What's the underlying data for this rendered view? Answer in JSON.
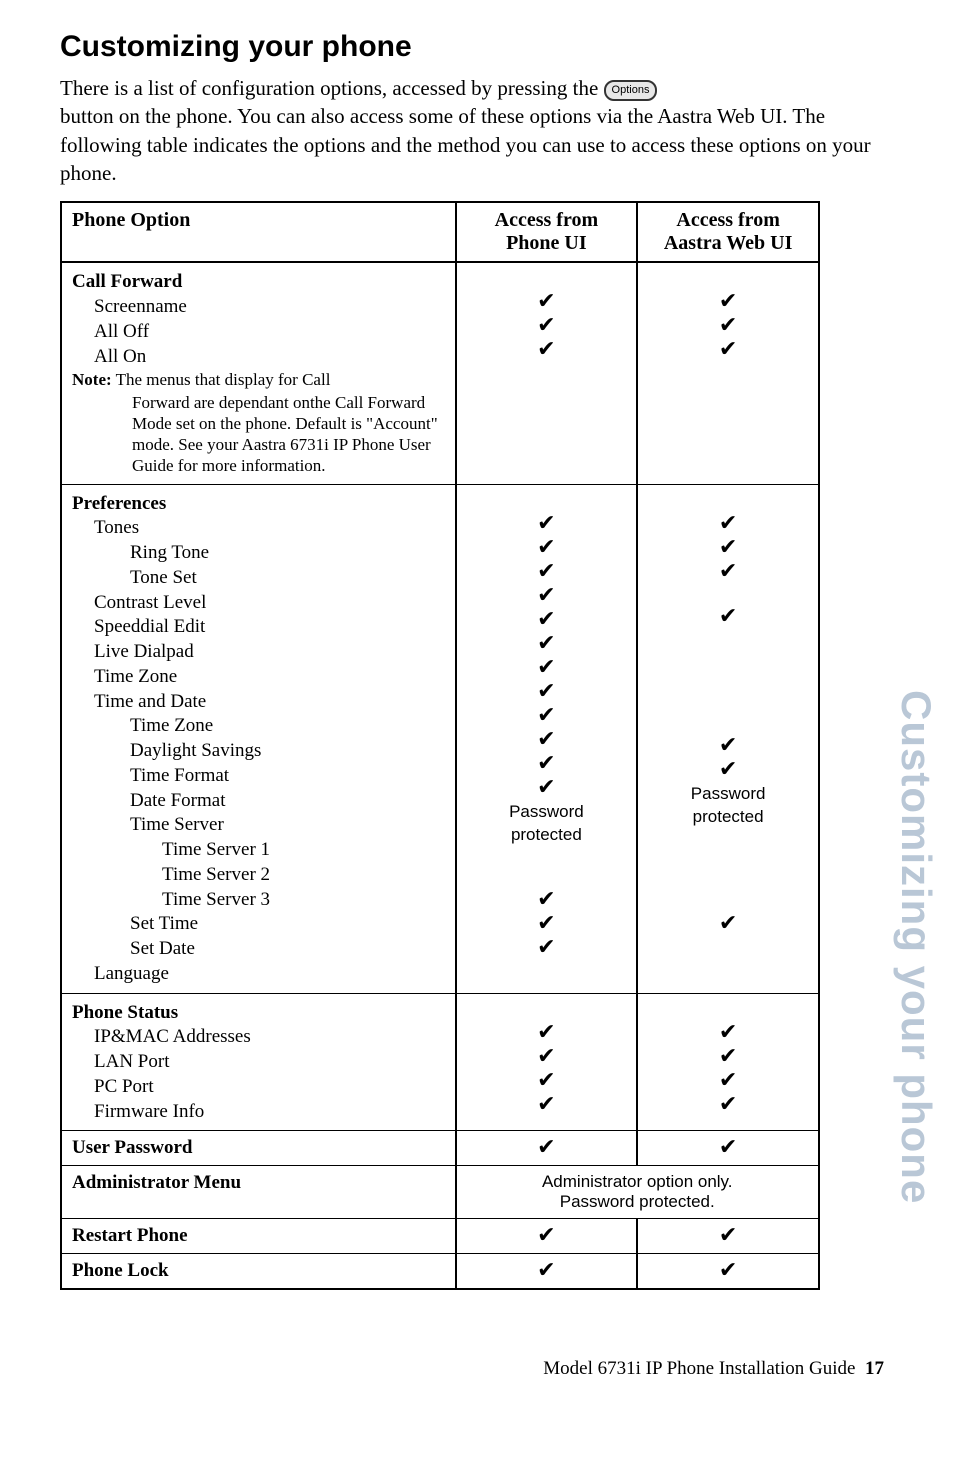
{
  "title": "Customizing your phone",
  "intro_lines": [
    "There is a list of configuration options, accessed by pressing the",
    "button on the phone. You can also access some of these options via the Aastra Web UI. The following table indicates the options and the method you can use to access these options on your phone."
  ],
  "options_chip": "Options",
  "table": {
    "headers": {
      "option": "Phone Option",
      "phone_ui": "Access from Phone UI",
      "web_ui": "Access from Aastra Web UI"
    },
    "sections": [
      {
        "group": "Call Forward",
        "items": [
          {
            "label": "Screenname",
            "indent": 1,
            "phone": "check",
            "web": "check"
          },
          {
            "label": "All Off",
            "indent": 1,
            "phone": "check",
            "web": "check"
          },
          {
            "label": "All On",
            "indent": 1,
            "phone": "check",
            "web": "check"
          }
        ],
        "note": {
          "label": "Note:",
          "first_line": "The menus that display for Call",
          "rest": "Forward are dependant onthe Call Forward Mode set on the phone. Default is \"Account\" mode. See your Aastra 6731i IP Phone User Guide for more information."
        }
      },
      {
        "group": "Preferences",
        "items": [
          {
            "label": "Tones",
            "indent": 1,
            "phone": "check",
            "web": "check"
          },
          {
            "label": "Ring Tone",
            "indent": 2,
            "phone": "check",
            "web": "check"
          },
          {
            "label": "Tone Set",
            "indent": 2,
            "phone": "check",
            "web": "check"
          },
          {
            "label": "Contrast Level",
            "indent": 1,
            "phone": "check",
            "web": ""
          },
          {
            "label": "Speeddial Edit",
            "indent": 1,
            "phone": "check",
            "web": "check"
          },
          {
            "label": "Live Dialpad",
            "indent": 1,
            "phone": "check",
            "web": ""
          },
          {
            "label": "Time Zone",
            "indent": 1,
            "phone": "check",
            "web": ""
          },
          {
            "label": "Time and Date",
            "indent": 1,
            "phone": "check",
            "web": ""
          },
          {
            "label": "Time Zone",
            "indent": 2,
            "phone": "check",
            "web": ""
          },
          {
            "label": "Daylight Savings",
            "indent": 2,
            "phone": "check",
            "web": ""
          },
          {
            "label": "Time Format",
            "indent": 2,
            "phone": "check",
            "web": "check"
          },
          {
            "label": "Date Format",
            "indent": 2,
            "phone": "check",
            "web": "check"
          },
          {
            "label": "Time Server",
            "indent": 2,
            "phone": "Password",
            "web": "Password"
          },
          {
            "label": "Time Server 1",
            "indent": 3,
            "phone": "protected",
            "web": "protected"
          },
          {
            "label": "Time Server 2",
            "indent": 3,
            "phone": "",
            "web": ""
          },
          {
            "label": "Time Server 3",
            "indent": 3,
            "phone": "",
            "web": ""
          },
          {
            "label": "Set Time",
            "indent": 2,
            "phone": "check",
            "web": ""
          },
          {
            "label": "Set Date",
            "indent": 2,
            "phone": "check",
            "web": ""
          },
          {
            "label": "Language",
            "indent": 1,
            "phone": "check",
            "web": "check"
          }
        ]
      },
      {
        "group": "Phone Status",
        "items": [
          {
            "label": "IP&MAC Addresses",
            "indent": 1,
            "phone": "check",
            "web": "check"
          },
          {
            "label": "LAN Port",
            "indent": 1,
            "phone": "check",
            "web": "check"
          },
          {
            "label": "PC Port",
            "indent": 1,
            "phone": "check",
            "web": "check"
          },
          {
            "label": "Firmware Info",
            "indent": 1,
            "phone": "check",
            "web": "check"
          }
        ]
      },
      {
        "group": "User Password",
        "single_row": true,
        "phone": "check",
        "web": "check"
      },
      {
        "group": "Administrator Menu",
        "admin_note": "Administrator option only.\nPassword protected."
      },
      {
        "group": "Restart Phone",
        "single_row": true,
        "phone": "check",
        "web": "check"
      },
      {
        "group": "Phone Lock",
        "single_row": true,
        "phone": "check",
        "web": "check"
      }
    ]
  },
  "sidebar": "Customizing your phone",
  "footer": {
    "text": "Model 6731i IP Phone Installation Guide",
    "page": "17"
  },
  "check_glyph": "✔"
}
